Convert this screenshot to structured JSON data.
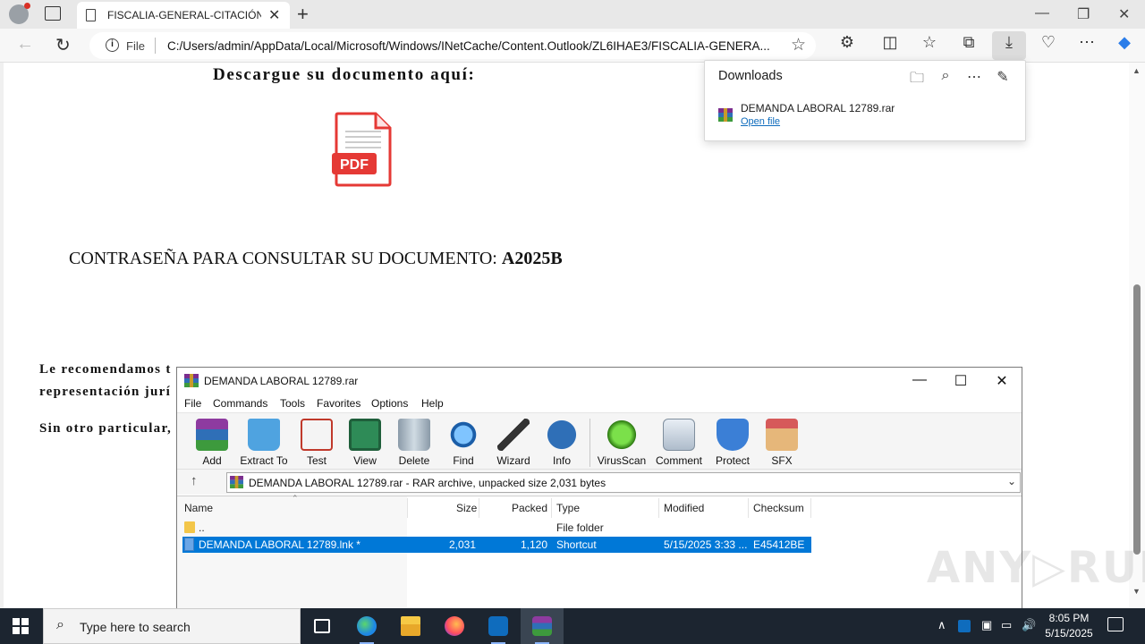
{
  "browser": {
    "tab_title": "FISCALIA-GENERAL-CITACIÓN-P",
    "url_scheme": "File",
    "url": "C:/Users/admin/AppData/Local/Microsoft/Windows/INetCache/Content.Outlook/ZL6IHAE3/FISCALIA-GENERA..."
  },
  "page": {
    "headline": "Descargue su documento aquí:",
    "pdf_label": "PDF",
    "password_label": "CONTRASEÑA PARA CONSULTAR SU DOCUMENTO:",
    "password_value": "A2025B",
    "para1_line1": "Le recomendamos t",
    "para1_line2": "representación jurí",
    "para2": "Sin otro particular,"
  },
  "downloads": {
    "title": "Downloads",
    "file_name": "DEMANDA LABORAL 12789.rar",
    "open_link": "Open file"
  },
  "winrar": {
    "title": "DEMANDA LABORAL 12789.rar",
    "menu": [
      "File",
      "Commands",
      "Tools",
      "Favorites",
      "Options",
      "Help"
    ],
    "tools": [
      "Add",
      "Extract To",
      "Test",
      "View",
      "Delete",
      "Find",
      "Wizard",
      "Info",
      "VirusScan",
      "Comment",
      "Protect",
      "SFX"
    ],
    "path": "DEMANDA LABORAL 12789.rar - RAR archive, unpacked size 2,031 bytes",
    "columns": [
      "Name",
      "Size",
      "Packed",
      "Type",
      "Modified",
      "Checksum"
    ],
    "rows": [
      {
        "name": "..",
        "size": "",
        "packed": "",
        "type": "File folder",
        "modified": "",
        "checksum": ""
      },
      {
        "name": "DEMANDA LABORAL 12789.lnk *",
        "size": "2,031",
        "packed": "1,120",
        "type": "Shortcut",
        "modified": "5/15/2025 3:33 ...",
        "checksum": "E45412BE"
      }
    ]
  },
  "taskbar": {
    "search_placeholder": "Type here to search",
    "time": "8:05 PM",
    "date": "5/15/2025"
  },
  "colors": {
    "selection": "#0078d7",
    "link": "#0f6cbd",
    "taskbar": "#1c2530"
  }
}
